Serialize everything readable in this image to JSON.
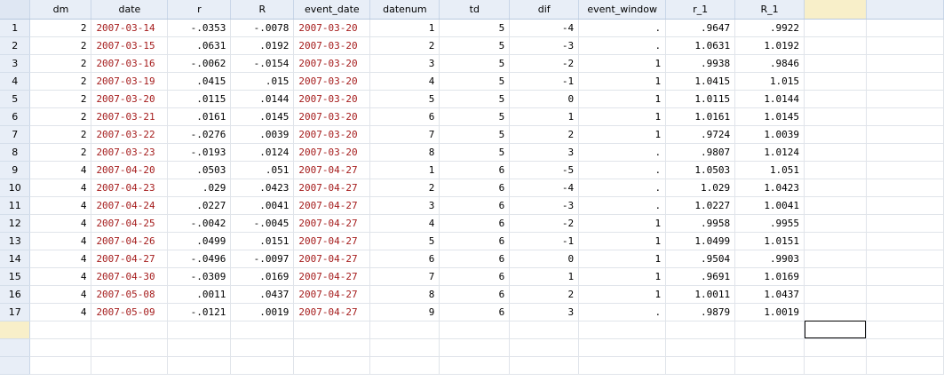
{
  "headers": [
    "",
    "dm",
    "date",
    "r",
    "R",
    "event_date",
    "datenum",
    "td",
    "dif",
    "event_window",
    "r_1",
    "R_1",
    "",
    ""
  ],
  "rows": [
    [
      "1",
      "2",
      "2007-03-14",
      "-.0353",
      "-.0078",
      "2007-03-20",
      "1",
      "5",
      "-4",
      ".",
      ".9647",
      ".9922"
    ],
    [
      "2",
      "2",
      "2007-03-15",
      ".0631",
      ".0192",
      "2007-03-20",
      "2",
      "5",
      "-3",
      ".",
      "1.0631",
      "1.0192"
    ],
    [
      "3",
      "2",
      "2007-03-16",
      "-.0062",
      "-.0154",
      "2007-03-20",
      "3",
      "5",
      "-2",
      "1",
      ".9938",
      ".9846"
    ],
    [
      "4",
      "2",
      "2007-03-19",
      ".0415",
      ".015",
      "2007-03-20",
      "4",
      "5",
      "-1",
      "1",
      "1.0415",
      "1.015"
    ],
    [
      "5",
      "2",
      "2007-03-20",
      ".0115",
      ".0144",
      "2007-03-20",
      "5",
      "5",
      "0",
      "1",
      "1.0115",
      "1.0144"
    ],
    [
      "6",
      "2",
      "2007-03-21",
      ".0161",
      ".0145",
      "2007-03-20",
      "6",
      "5",
      "1",
      "1",
      "1.0161",
      "1.0145"
    ],
    [
      "7",
      "2",
      "2007-03-22",
      "-.0276",
      ".0039",
      "2007-03-20",
      "7",
      "5",
      "2",
      "1",
      ".9724",
      "1.0039"
    ],
    [
      "8",
      "2",
      "2007-03-23",
      "-.0193",
      ".0124",
      "2007-03-20",
      "8",
      "5",
      "3",
      ".",
      ".9807",
      "1.0124"
    ],
    [
      "9",
      "4",
      "2007-04-20",
      ".0503",
      ".051",
      "2007-04-27",
      "1",
      "6",
      "-5",
      ".",
      "1.0503",
      "1.051"
    ],
    [
      "10",
      "4",
      "2007-04-23",
      ".029",
      ".0423",
      "2007-04-27",
      "2",
      "6",
      "-4",
      ".",
      "1.029",
      "1.0423"
    ],
    [
      "11",
      "4",
      "2007-04-24",
      ".0227",
      ".0041",
      "2007-04-27",
      "3",
      "6",
      "-3",
      ".",
      "1.0227",
      "1.0041"
    ],
    [
      "12",
      "4",
      "2007-04-25",
      "-.0042",
      "-.0045",
      "2007-04-27",
      "4",
      "6",
      "-2",
      "1",
      ".9958",
      ".9955"
    ],
    [
      "13",
      "4",
      "2007-04-26",
      ".0499",
      ".0151",
      "2007-04-27",
      "5",
      "6",
      "-1",
      "1",
      "1.0499",
      "1.0151"
    ],
    [
      "14",
      "4",
      "2007-04-27",
      "-.0496",
      "-.0097",
      "2007-04-27",
      "6",
      "6",
      "0",
      "1",
      ".9504",
      ".9903"
    ],
    [
      "15",
      "4",
      "2007-04-30",
      "-.0309",
      ".0169",
      "2007-04-27",
      "7",
      "6",
      "1",
      "1",
      ".9691",
      "1.0169"
    ],
    [
      "16",
      "4",
      "2007-05-08",
      ".0011",
      ".0437",
      "2007-04-27",
      "8",
      "6",
      "2",
      "1",
      "1.0011",
      "1.0437"
    ],
    [
      "17",
      "4",
      "2007-05-09",
      "-.0121",
      ".0019",
      "2007-04-27",
      "9",
      "6",
      "3",
      ".",
      ".9879",
      "1.0019"
    ]
  ],
  "empty_rows": 3,
  "colors": {
    "header_bg": "#e8eef7",
    "active_bg": "#f8efc9",
    "date_text": "#a51c1c"
  }
}
